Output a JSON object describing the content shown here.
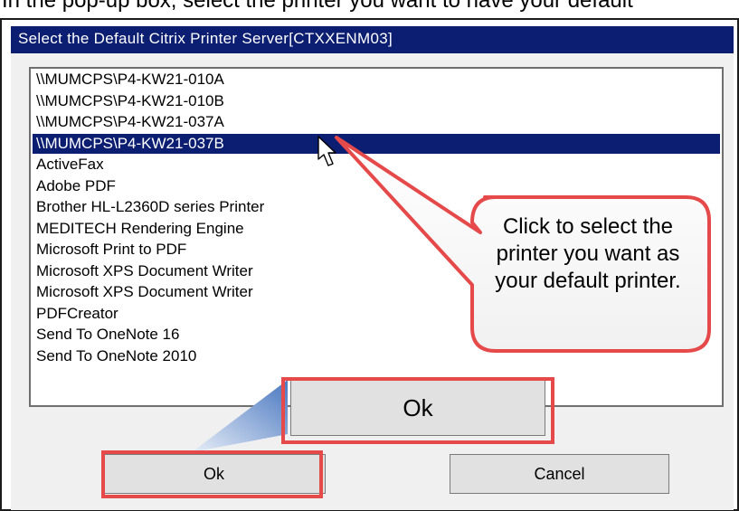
{
  "context_line": "In the pop-up box, select the printer you want to have your default",
  "dialog": {
    "title": "Select the Default Citrix Printer Server[CTXXENM03]",
    "printers": [
      "\\\\MUMCPS\\P4-KW21-010A",
      "\\\\MUMCPS\\P4-KW21-010B",
      "\\\\MUMCPS\\P4-KW21-037A",
      "\\\\MUMCPS\\P4-KW21-037B",
      "ActiveFax",
      "Adobe PDF",
      "Brother HL-L2360D series Printer",
      "MEDITECH Rendering Engine",
      "Microsoft Print to PDF",
      "Microsoft XPS Document Writer",
      "Microsoft XPS Document Writer",
      "PDFCreator",
      "Send To OneNote 16",
      "Send To OneNote 2010"
    ],
    "selected_printer": "\\\\MUMCPS\\P4-KW21-037B",
    "ok_label": "Ok",
    "cancel_label": "Cancel"
  },
  "annotation": {
    "callout_text": "Click to select the printer you want as your default printer.",
    "zoom_ok_label": "Ok",
    "colors": {
      "highlight": "#e5494a",
      "pointer": "#4a78c0"
    }
  },
  "colors": {
    "titlebar": "#0b1e72",
    "selection": "#0b1e72",
    "dialog_bg": "#f0f0f0"
  }
}
